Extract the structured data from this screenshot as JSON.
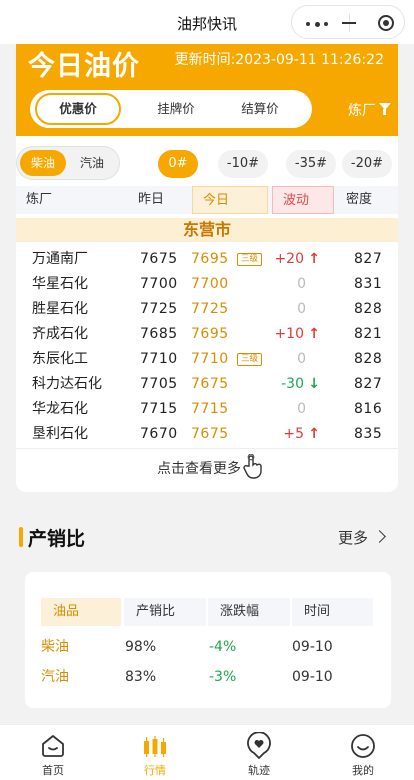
{
  "navbar": {
    "title": "油邦快讯"
  },
  "header": {
    "title": "今日油价",
    "update_time": "更新时间:2023-09-11 11:26:22",
    "price_tabs": [
      "优惠价",
      "挂牌价",
      "结算价"
    ],
    "refinery_filter": "炼厂"
  },
  "fuel_types": [
    "柴油",
    "汽油"
  ],
  "grades": [
    "0#",
    "-10#",
    "-35#",
    "-20#"
  ],
  "table": {
    "headers": [
      "炼厂",
      "昨日",
      "今日",
      "波动",
      "密度"
    ],
    "city": "东营市",
    "rows": [
      {
        "name": "万通南厂",
        "yesterday": "7675",
        "today": "7695",
        "tag": "三级",
        "change": "+20",
        "dir": "up",
        "density": "827"
      },
      {
        "name": "华星石化",
        "yesterday": "7700",
        "today": "7700",
        "tag": "",
        "change": "0",
        "dir": "flat",
        "density": "831"
      },
      {
        "name": "胜星石化",
        "yesterday": "7725",
        "today": "7725",
        "tag": "",
        "change": "0",
        "dir": "flat",
        "density": "828"
      },
      {
        "name": "齐成石化",
        "yesterday": "7685",
        "today": "7695",
        "tag": "",
        "change": "+10",
        "dir": "up",
        "density": "821"
      },
      {
        "name": "东辰化工",
        "yesterday": "7710",
        "today": "7710",
        "tag": "三级",
        "change": "0",
        "dir": "flat",
        "density": "828"
      },
      {
        "name": "科力达石化",
        "yesterday": "7705",
        "today": "7675",
        "tag": "",
        "change": "-30",
        "dir": "down",
        "density": "827"
      },
      {
        "name": "华龙石化",
        "yesterday": "7715",
        "today": "7715",
        "tag": "",
        "change": "0",
        "dir": "flat",
        "density": "816"
      },
      {
        "name": "垦利石化",
        "yesterday": "7670",
        "today": "7675",
        "tag": "",
        "change": "+5",
        "dir": "up",
        "density": "835"
      }
    ],
    "more_label": "点击查看更多"
  },
  "ratio": {
    "title": "产销比",
    "more_label": "更多",
    "headers": [
      "油品",
      "产销比",
      "涨跌幅",
      "时间"
    ],
    "rows": [
      {
        "product": "柴油",
        "ratio": "98%",
        "change": "-4%",
        "date": "09-10"
      },
      {
        "product": "汽油",
        "ratio": "83%",
        "change": "-3%",
        "date": "09-10"
      }
    ]
  },
  "tabbar": [
    "首页",
    "行情",
    "轨迹",
    "我的"
  ],
  "colors": {
    "accent": "#f7a800",
    "up": "#e03b3b",
    "down": "#1ea84f"
  }
}
